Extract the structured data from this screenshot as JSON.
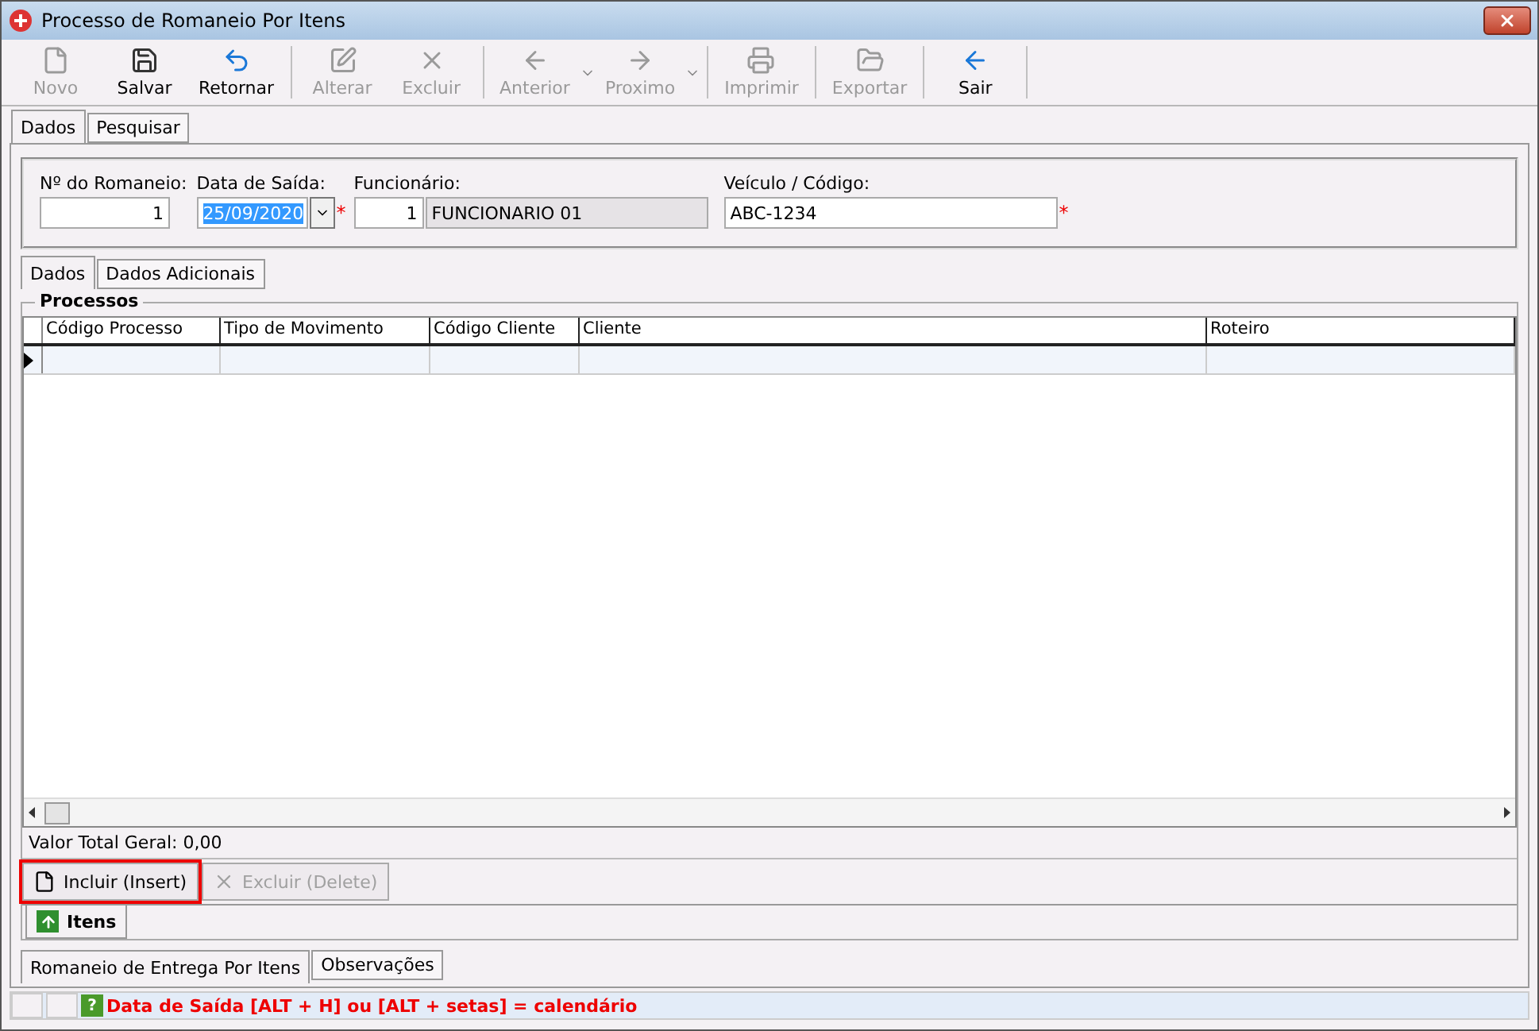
{
  "window": {
    "title": "Processo de Romaneio Por Itens"
  },
  "toolbar": [
    {
      "label": "Novo",
      "disabled": true,
      "kind": "button"
    },
    {
      "label": "Salvar",
      "disabled": false,
      "kind": "button"
    },
    {
      "label": "Retornar",
      "disabled": false,
      "kind": "button"
    },
    {
      "label": "Alterar",
      "disabled": true,
      "kind": "button"
    },
    {
      "label": "Excluir",
      "disabled": true,
      "kind": "button"
    },
    {
      "label": "Anterior",
      "disabled": true,
      "kind": "dropdown"
    },
    {
      "label": "Proximo",
      "disabled": true,
      "kind": "dropdown"
    },
    {
      "label": "Imprimir",
      "disabled": true,
      "kind": "button"
    },
    {
      "label": "Exportar",
      "disabled": true,
      "kind": "button"
    },
    {
      "label": "Sair",
      "disabled": false,
      "kind": "button"
    }
  ],
  "top_tabs": [
    {
      "label": "Dados",
      "selected": true
    },
    {
      "label": "Pesquisar",
      "selected": false
    }
  ],
  "form": {
    "romaneio": {
      "label": "Nº do Romaneio:",
      "value": "1"
    },
    "data_saida": {
      "label": "Data de Saída:",
      "value": "25/09/2020",
      "required": true,
      "required_mark": "*"
    },
    "funcionario": {
      "label": "Funcionário:",
      "code": "1",
      "name": "FUNCIONARIO 01"
    },
    "veiculo": {
      "label": "Veículo / Código:",
      "value": "ABC-1234",
      "required": true,
      "required_mark": "*"
    }
  },
  "sub_tabs": [
    {
      "label": "Dados",
      "selected": true
    },
    {
      "label": "Dados Adicionais",
      "selected": false
    }
  ],
  "processos": {
    "title": "Processos",
    "columns": [
      "Código Processo",
      "Tipo de Movimento",
      "Código Cliente",
      "Cliente",
      "Roteiro"
    ],
    "total": "Valor Total Geral: 0,00"
  },
  "actions": [
    {
      "label": "Incluir (Insert)",
      "disabled": false,
      "focused": true
    },
    {
      "label": "Excluir (Delete)",
      "disabled": true,
      "focused": false
    }
  ],
  "detail_tabs": [
    {
      "label": "Itens",
      "selected": true
    }
  ],
  "bottom_tabs": [
    {
      "label": "Romaneio de Entrega Por Itens",
      "selected": true
    },
    {
      "label": "Observações",
      "selected": false
    }
  ],
  "status_bar": {
    "help": "?",
    "message": "Data de Saída [ALT + H] ou [ALT + setas] = calendário"
  }
}
